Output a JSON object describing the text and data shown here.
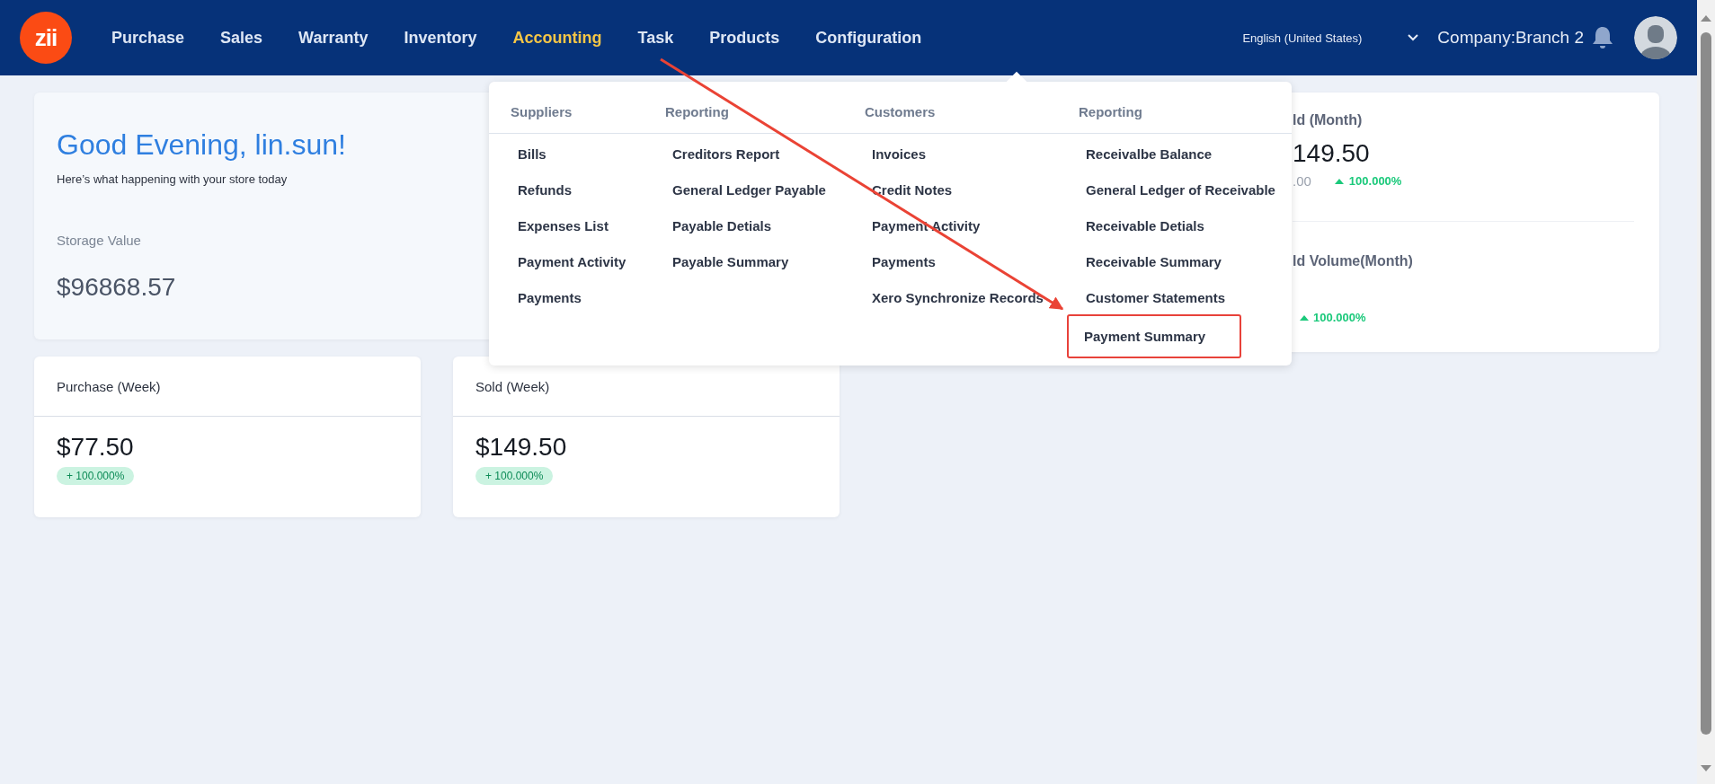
{
  "header": {
    "logo": "zii",
    "nav": [
      {
        "label": "Purchase",
        "selected": false
      },
      {
        "label": "Sales",
        "selected": false
      },
      {
        "label": "Warranty",
        "selected": false
      },
      {
        "label": "Inventory",
        "selected": false
      },
      {
        "label": "Accounting",
        "selected": true
      },
      {
        "label": "Task",
        "selected": false
      },
      {
        "label": "Products",
        "selected": false
      },
      {
        "label": "Configuration",
        "selected": false
      }
    ],
    "language": "English (United States)",
    "company": "Company:Branch 2"
  },
  "greeting": {
    "title": "Good Evening, lin.sun!",
    "subtitle": "Here’s what happening with your store today",
    "storage_label": "Storage Value",
    "storage_value": "$96868.57"
  },
  "month_card": {
    "title": "ld (Month)",
    "amount": "149.50",
    "previous": ".00",
    "change": "100.000%",
    "volume_title": "ld Volume(Month)",
    "volume_change": "100.000%"
  },
  "week_cards": [
    {
      "title": "Purchase (Week)",
      "amount": "$77.50",
      "change": "+ 100.000%"
    },
    {
      "title": "Sold (Week)",
      "amount": "$149.50",
      "change": "+ 100.000%"
    }
  ],
  "accounting_menu": {
    "columns": [
      {
        "heading": "Suppliers",
        "items": [
          {
            "label": "Bills",
            "highlighted": false
          },
          {
            "label": "Refunds",
            "highlighted": false
          },
          {
            "label": "Expenses List",
            "highlighted": false
          },
          {
            "label": "Payment Activity",
            "highlighted": false
          },
          {
            "label": "Payments",
            "highlighted": false
          }
        ]
      },
      {
        "heading": "Reporting",
        "items": [
          {
            "label": "Creditors Report",
            "highlighted": false
          },
          {
            "label": "General Ledger Payable",
            "highlighted": false
          },
          {
            "label": "Payable Detials",
            "highlighted": false
          },
          {
            "label": "Payable Summary",
            "highlighted": false
          }
        ]
      },
      {
        "heading": "Customers",
        "items": [
          {
            "label": "Invoices",
            "highlighted": false
          },
          {
            "label": "Credit Notes",
            "highlighted": false
          },
          {
            "label": "Payment Activity",
            "highlighted": false
          },
          {
            "label": "Payments",
            "highlighted": false
          },
          {
            "label": "Xero Synchronize Records",
            "highlighted": false
          }
        ]
      },
      {
        "heading": "Reporting",
        "items": [
          {
            "label": "Receivalbe Balance",
            "highlighted": false
          },
          {
            "label": "General Ledger of Receivable",
            "highlighted": false
          },
          {
            "label": "Receivable Detials",
            "highlighted": false
          },
          {
            "label": "Receivable Summary",
            "highlighted": false
          },
          {
            "label": "Customer Statements",
            "highlighted": false
          },
          {
            "label": "Payment Summary",
            "highlighted": true
          }
        ]
      }
    ]
  }
}
